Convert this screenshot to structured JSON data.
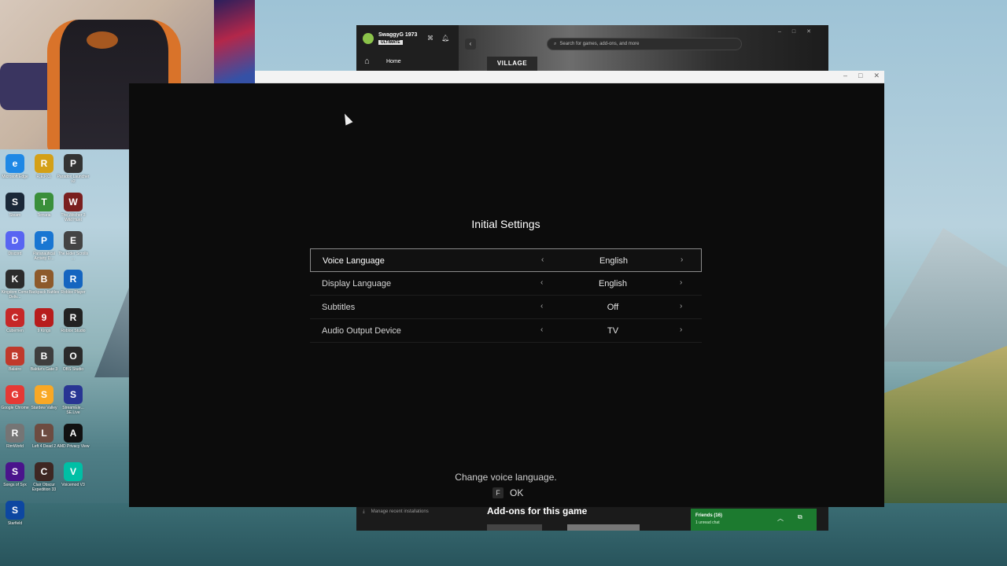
{
  "desktop": {
    "icons": [
      {
        "label": "Microsoft Edge",
        "icon": "edge-icon",
        "color": "#1e88e5",
        "glyph": "e"
      },
      {
        "label": "R.E.P.O.",
        "icon": "repo-icon",
        "color": "#d4a017",
        "glyph": "R"
      },
      {
        "label": "Paradox Launcher v2",
        "icon": "paradox-icon",
        "color": "#333333",
        "glyph": "P"
      },
      {
        "label": "Steam",
        "icon": "steam-icon",
        "color": "#1b2838",
        "glyph": "S"
      },
      {
        "label": "Terraria",
        "icon": "terraria-icon",
        "color": "#3a8f3a",
        "glyph": "T"
      },
      {
        "label": "The Witcher 3 Wild Hunt",
        "icon": "witcher-icon",
        "color": "#7a1f1f",
        "glyph": "W"
      },
      {
        "label": "Discord",
        "icon": "discord-icon",
        "color": "#5865f2",
        "glyph": "D"
      },
      {
        "label": "Paranautical Activity D...",
        "icon": "paranautical-icon",
        "color": "#1976d2",
        "glyph": "P"
      },
      {
        "label": "The Elder Scrolls ...",
        "icon": "elder-scrolls-icon",
        "color": "#444444",
        "glyph": "E"
      },
      {
        "label": "Kingdom Come Deliv...",
        "icon": "kingdom-come-icon",
        "color": "#2b2b2b",
        "glyph": "K"
      },
      {
        "label": "Backpack Battles",
        "icon": "backpack-battles-icon",
        "color": "#8d5a2b",
        "glyph": "B"
      },
      {
        "label": "Roblox Player",
        "icon": "roblox-player-icon",
        "color": "#1565c0",
        "glyph": "R"
      },
      {
        "label": "Cubemen",
        "icon": "cubemen-icon",
        "color": "#c62828",
        "glyph": "C"
      },
      {
        "label": "9 Kings",
        "icon": "nine-kings-icon",
        "color": "#b71c1c",
        "glyph": "9"
      },
      {
        "label": "Roblox Studio",
        "icon": "roblox-studio-icon",
        "color": "#222222",
        "glyph": "R"
      },
      {
        "label": "Balatro",
        "icon": "balatro-icon",
        "color": "#c0392b",
        "glyph": "B"
      },
      {
        "label": "Baldur's Gate 3",
        "icon": "baldurs-gate-icon",
        "color": "#3e3e3e",
        "glyph": "B"
      },
      {
        "label": "OBS Studio",
        "icon": "obs-icon",
        "color": "#2a2a2a",
        "glyph": "O"
      },
      {
        "label": "Google Chrome",
        "icon": "chrome-icon",
        "color": "#e53935",
        "glyph": "G"
      },
      {
        "label": "Stardew Valley",
        "icon": "stardew-icon",
        "color": "#f9a825",
        "glyph": "S"
      },
      {
        "label": "StreamEle... SE.Live",
        "icon": "streamelements-icon",
        "color": "#283593",
        "glyph": "S"
      },
      {
        "label": "RimWorld",
        "icon": "rimworld-icon",
        "color": "#757575",
        "glyph": "R"
      },
      {
        "label": "Left 4 Dead 2",
        "icon": "left4dead-icon",
        "color": "#6d4c41",
        "glyph": "L"
      },
      {
        "label": "AMD Privacy View",
        "icon": "amd-icon",
        "color": "#111111",
        "glyph": "A"
      },
      {
        "label": "Songs of Syx",
        "icon": "songs-of-syx-icon",
        "color": "#4a148c",
        "glyph": "S"
      },
      {
        "label": "Clair Obscur Expedition 33",
        "icon": "clair-obscur-icon",
        "color": "#3e2723",
        "glyph": "C"
      },
      {
        "label": "Voicemod V3",
        "icon": "voicemod-icon",
        "color": "#00bfa5",
        "glyph": "V"
      },
      {
        "label": "Starfield",
        "icon": "starfield-icon",
        "color": "#0d47a1",
        "glyph": "S"
      }
    ]
  },
  "xbox": {
    "username": "SwaggyG 1973",
    "tier": "ULTIMATE",
    "home": "Home",
    "search_placeholder": "Search for games, add-ons, and more",
    "hero_logo": "VILLAGE",
    "manage": "Manage recent installations",
    "addons_heading": "Add-ons for this game",
    "friends": "Friends (16)",
    "unread": "1 unread chat"
  },
  "game": {
    "title": "Initial Settings",
    "settings": [
      {
        "name": "Voice Language",
        "value": "English",
        "selected": true
      },
      {
        "name": "Display Language",
        "value": "English",
        "selected": false
      },
      {
        "name": "Subtitles",
        "value": "Off",
        "selected": false
      },
      {
        "name": "Audio Output Device",
        "value": "TV",
        "selected": false
      }
    ],
    "hint": "Change voice language.",
    "confirm_key": "F",
    "confirm_label": "OK"
  }
}
